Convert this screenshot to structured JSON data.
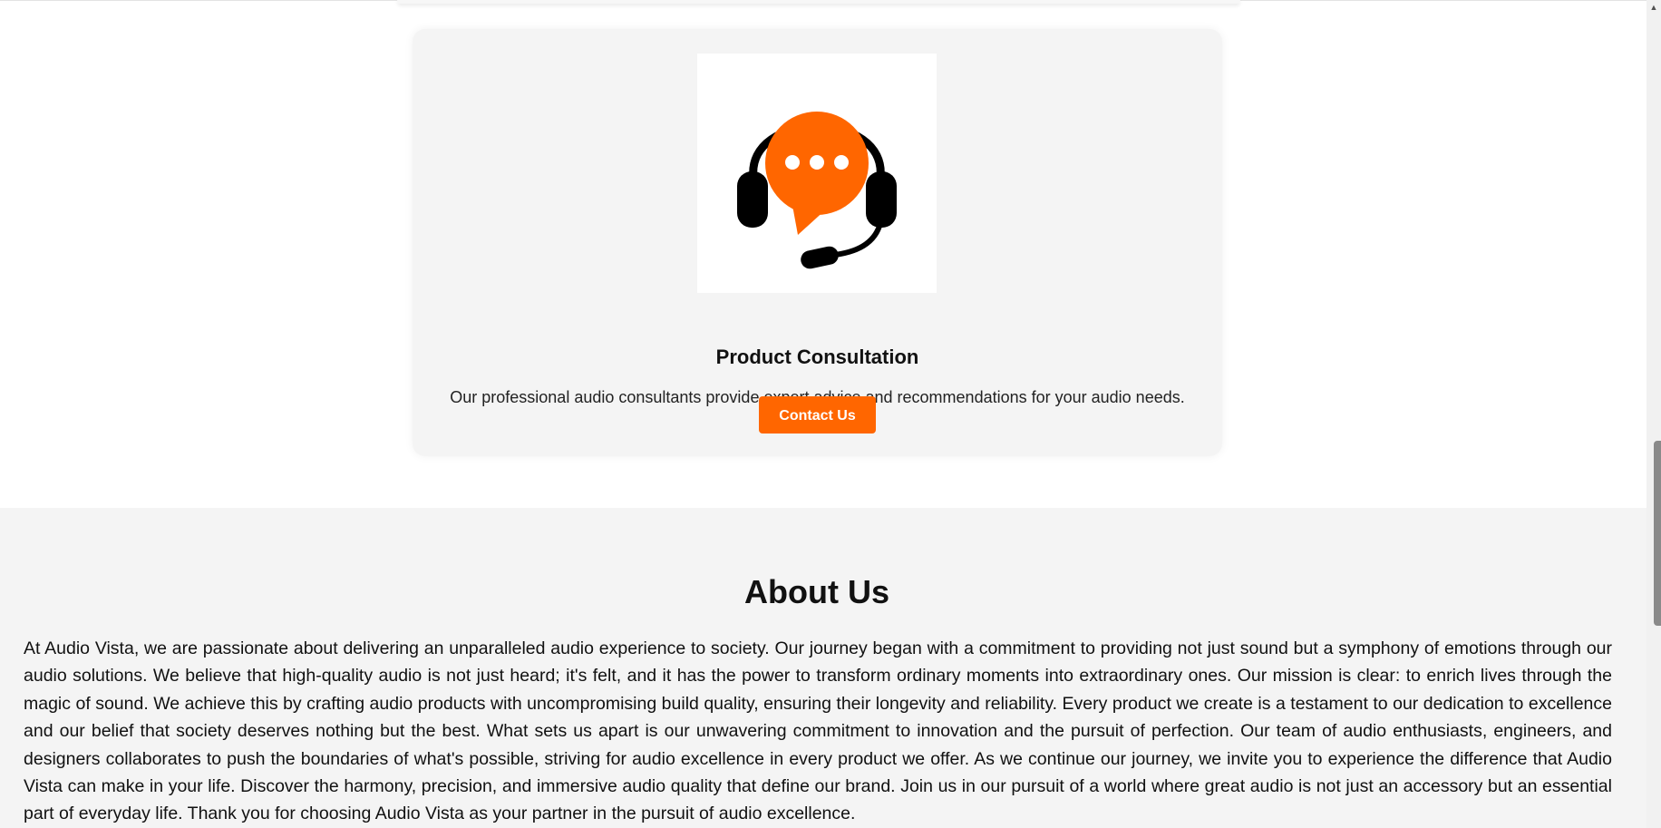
{
  "service": {
    "title": "Product Consultation",
    "description": "Our professional audio consultants provide expert advice and recommendations for your audio needs.",
    "button_label": "Contact Us",
    "image_icon": "headset-chat-icon"
  },
  "about": {
    "title": "About Us",
    "text": "At Audio Vista, we are passionate about delivering an unparalleled audio experience to society. Our journey began with a commitment to providing not just sound but a symphony of emotions through our audio solutions. We believe that high-quality audio is not just heard; it's felt, and it has the power to transform ordinary moments into extraordinary ones. Our mission is clear: to enrich lives through the magic of sound. We achieve this by crafting audio products with uncompromising build quality, ensuring their longevity and reliability. Every product we create is a testament to our dedication to excellence and our belief that society deserves nothing but the best. What sets us apart is our unwavering commitment to innovation and the pursuit of perfection. Our team of audio enthusiasts, engineers, and designers collaborates to push the boundaries of what's possible, striving for audio excellence in every product we offer. As we continue our journey, we invite you to experience the difference that Audio Vista can make in your life. Discover the harmony, precision, and immersive audio quality that define our brand. Join us in our pursuit of a world where great audio is not just an accessory but an essential part of everyday life. Thank you for choosing Audio Vista as your partner in the pursuit of audio excellence."
  },
  "colors": {
    "accent": "#ff6600",
    "section_background": "#f4f4f4",
    "card_background": "#f4f4f4"
  },
  "scrollbar": {
    "up_icon": "scroll-up-arrow-icon"
  }
}
